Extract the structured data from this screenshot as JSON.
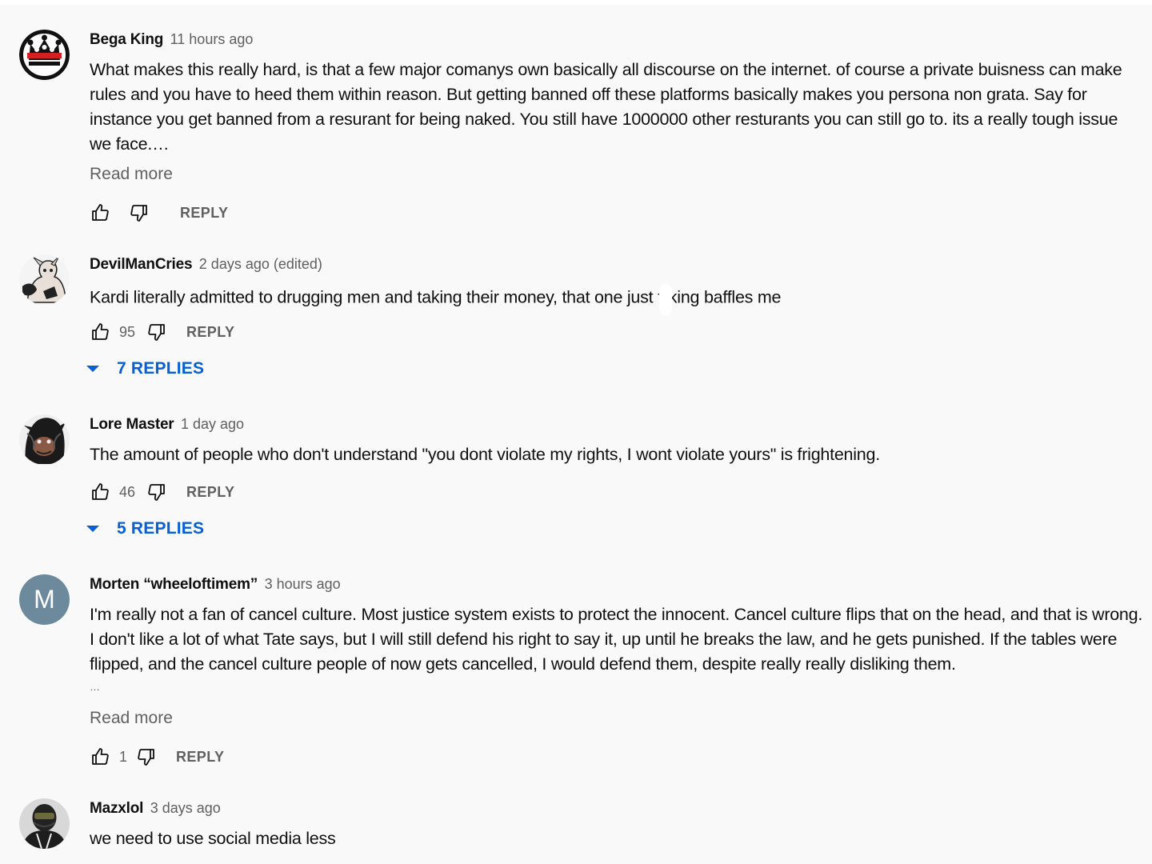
{
  "comments": [
    {
      "author": "Bega King",
      "time": "11 hours ago",
      "avatar": "crown-avatar",
      "text": "What makes this really hard, is that a few major comanys own basically all discourse on the internet. of course a private buisness can make rules and you have to heed them within reason. But getting banned off these platforms basically makes you persona non grata. Say for instance you get banned from a resurant for being naked. You still have 1000000 other resturants you can still go to. its a really tough issue we face.…",
      "read_more": "Read more",
      "likes": "",
      "reply_label": "REPLY"
    },
    {
      "author": "DevilManCries",
      "time": "2 days ago (edited)",
      "avatar": "anime-avatar",
      "text_before": "Kardi literally admitted to drugging men and taking their money, that one just f",
      "text_after": "king baffles me",
      "likes": "95",
      "reply_label": "REPLY",
      "replies": "7 REPLIES"
    },
    {
      "author": "Lore Master",
      "time": "1 day ago",
      "avatar": "dark-creature-avatar",
      "text": "The amount of people who don't understand \"you dont violate my rights, I wont violate yours\" is frightening.",
      "likes": "46",
      "reply_label": "REPLY",
      "replies": "5 REPLIES"
    },
    {
      "author": "Morten “wheeloftimem”",
      "time": "3 hours ago",
      "avatar_letter": "M",
      "text": "I'm really not a fan of cancel culture. Most justice system exists to protect the innocent. Cancel culture flips that on the head, and that is wrong. I don't like a lot of what Tate says, but I will still defend his right to say it, up until he breaks the law, and he gets punished. If the tables were flipped, and the cancel culture people of now gets cancelled, I would defend them, despite really really disliking them.",
      "ellipsis": "…",
      "read_more": "Read more",
      "likes": "1",
      "reply_label": "REPLY"
    },
    {
      "author": "Mazxlol",
      "time": "3 days ago",
      "avatar": "helmet-avatar",
      "text": "we need to use social media less"
    }
  ],
  "colors": {
    "background": "#f9f9f9",
    "link_blue": "#065fd4",
    "secondary_text": "#606060",
    "letter_avatar": "#6d8a9c"
  }
}
